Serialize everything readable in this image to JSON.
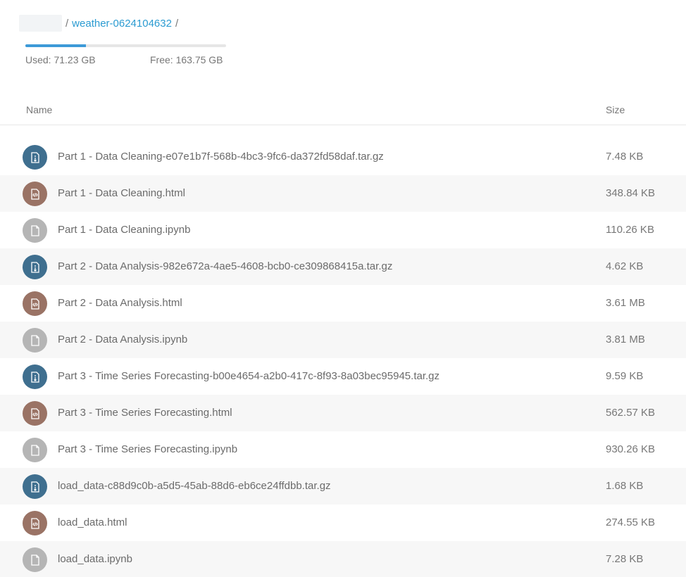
{
  "breadcrumb": {
    "separator": "/",
    "folder": "weather-0624104632"
  },
  "storage": {
    "used_label": "Used: 71.23 GB",
    "free_label": "Free: 163.75 GB",
    "used_fraction": 0.303,
    "bar_color": "#3d9ad8"
  },
  "table": {
    "headers": {
      "name": "Name",
      "size": "Size"
    },
    "rows": [
      {
        "name": "Part 1 - Data Cleaning-e07e1b7f-568b-4bc3-9fc6-da372fd58daf.tar.gz",
        "size": "7.48 KB",
        "icon": "archive-icon"
      },
      {
        "name": "Part 1 - Data Cleaning.html",
        "size": "348.84 KB",
        "icon": "html-file-icon"
      },
      {
        "name": "Part 1 - Data Cleaning.ipynb",
        "size": "110.26 KB",
        "icon": "document-icon"
      },
      {
        "name": "Part 2 - Data Analysis-982e672a-4ae5-4608-bcb0-ce309868415a.tar.gz",
        "size": "4.62 KB",
        "icon": "archive-icon"
      },
      {
        "name": "Part 2 - Data Analysis.html",
        "size": "3.61 MB",
        "icon": "html-file-icon"
      },
      {
        "name": "Part 2 - Data Analysis.ipynb",
        "size": "3.81 MB",
        "icon": "document-icon"
      },
      {
        "name": "Part 3 - Time Series Forecasting-b00e4654-a2b0-417c-8f93-8a03bec95945.tar.gz",
        "size": "9.59 KB",
        "icon": "archive-icon"
      },
      {
        "name": "Part 3 - Time Series Forecasting.html",
        "size": "562.57 KB",
        "icon": "html-file-icon"
      },
      {
        "name": "Part 3 - Time Series Forecasting.ipynb",
        "size": "930.26 KB",
        "icon": "document-icon"
      },
      {
        "name": "load_data-c88d9c0b-a5d5-45ab-88d6-eb6ce24ffdbb.tar.gz",
        "size": "1.68 KB",
        "icon": "archive-icon"
      },
      {
        "name": "load_data.html",
        "size": "274.55 KB",
        "icon": "html-file-icon"
      },
      {
        "name": "load_data.ipynb",
        "size": "7.28 KB",
        "icon": "document-icon"
      }
    ]
  },
  "colors": {
    "link": "#2b9bd1",
    "archive_icon_bg": "#3f6f8f",
    "html_icon_bg": "#9a7365",
    "document_icon_bg": "#b5b5b5"
  }
}
